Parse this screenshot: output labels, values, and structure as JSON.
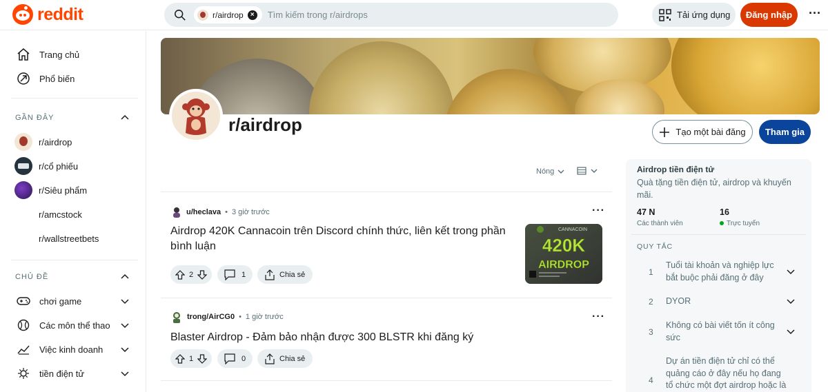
{
  "header": {
    "logo_text": "reddit",
    "search_chip": "r/airdrop",
    "search_placeholder": "Tìm kiếm trong r/airdrops",
    "app_button": "Tải ứng dụng",
    "login_button": "Đăng nhập",
    "more": "···"
  },
  "sidebar": {
    "nav": [
      {
        "label": "Trang chủ",
        "icon": "home-icon"
      },
      {
        "label": "Phổ biến",
        "icon": "popular-icon"
      }
    ],
    "recent_title": "GẦN ĐÂY",
    "recent": [
      {
        "label": "r/airdrop"
      },
      {
        "label": "r/cổ phiếu"
      },
      {
        "label": "r/Siêu phẩm"
      },
      {
        "label": "r/amcstock"
      },
      {
        "label": "r/wallstreetbets"
      }
    ],
    "topics_title": "CHỦ ĐỀ",
    "topics": [
      {
        "label": "chơi game",
        "icon": "gamepad-icon"
      },
      {
        "label": "Các môn thể thao",
        "icon": "sports-icon"
      },
      {
        "label": "Việc kinh doanh",
        "icon": "business-icon"
      },
      {
        "label": "tiền điện tử",
        "icon": "crypto-icon"
      }
    ]
  },
  "community": {
    "name": "r/airdrop",
    "create_post": "Tạo một bài đăng",
    "join": "Tham gia"
  },
  "feed": {
    "sort": "Nóng",
    "posts": [
      {
        "user": "u/heclava",
        "time": "3 giờ trước",
        "title": "Airdrop 420K Cannacoin trên Discord chính thức, liên kết trong phần bình luận",
        "votes": "2",
        "comments": "1",
        "share": "Chia sẻ",
        "thumb_top": "CANNACOIN",
        "thumb_big": "420K",
        "thumb_word": "AIRDROP"
      },
      {
        "user": "trong/AirCG0",
        "time": "1 giờ trước",
        "title": "Blaster Airdrop - Đảm bảo nhận được 300 BLSTR khi đăng ký",
        "votes": "1",
        "comments": "0",
        "share": "Chia sẻ"
      }
    ]
  },
  "about": {
    "title": "Airdrop tiền điện tử",
    "description": "Quà tặng tiền điện tử, airdrop và khuyến mãi.",
    "members": "47 N",
    "members_label": "Các thành viên",
    "online": "16",
    "online_label": "Trực tuyến",
    "rules_title": "QUY TẮC",
    "rules": [
      {
        "num": "1",
        "text": "Tuổi tài khoản và nghiệp lực bắt buộc phải đăng ở đây"
      },
      {
        "num": "2",
        "text": "DYOR"
      },
      {
        "num": "3",
        "text": "Không có bài viết tốn ít công sức"
      },
      {
        "num": "4",
        "text": "Dự án tiền điện tử chỉ có thể quảng cáo ở đây nếu họ đang tổ chức một đợt airdrop hoặc là"
      }
    ]
  },
  "colors": {
    "brand": "#ff4500",
    "login": "#d93900",
    "join": "#0a449b",
    "online": "#01a816"
  }
}
